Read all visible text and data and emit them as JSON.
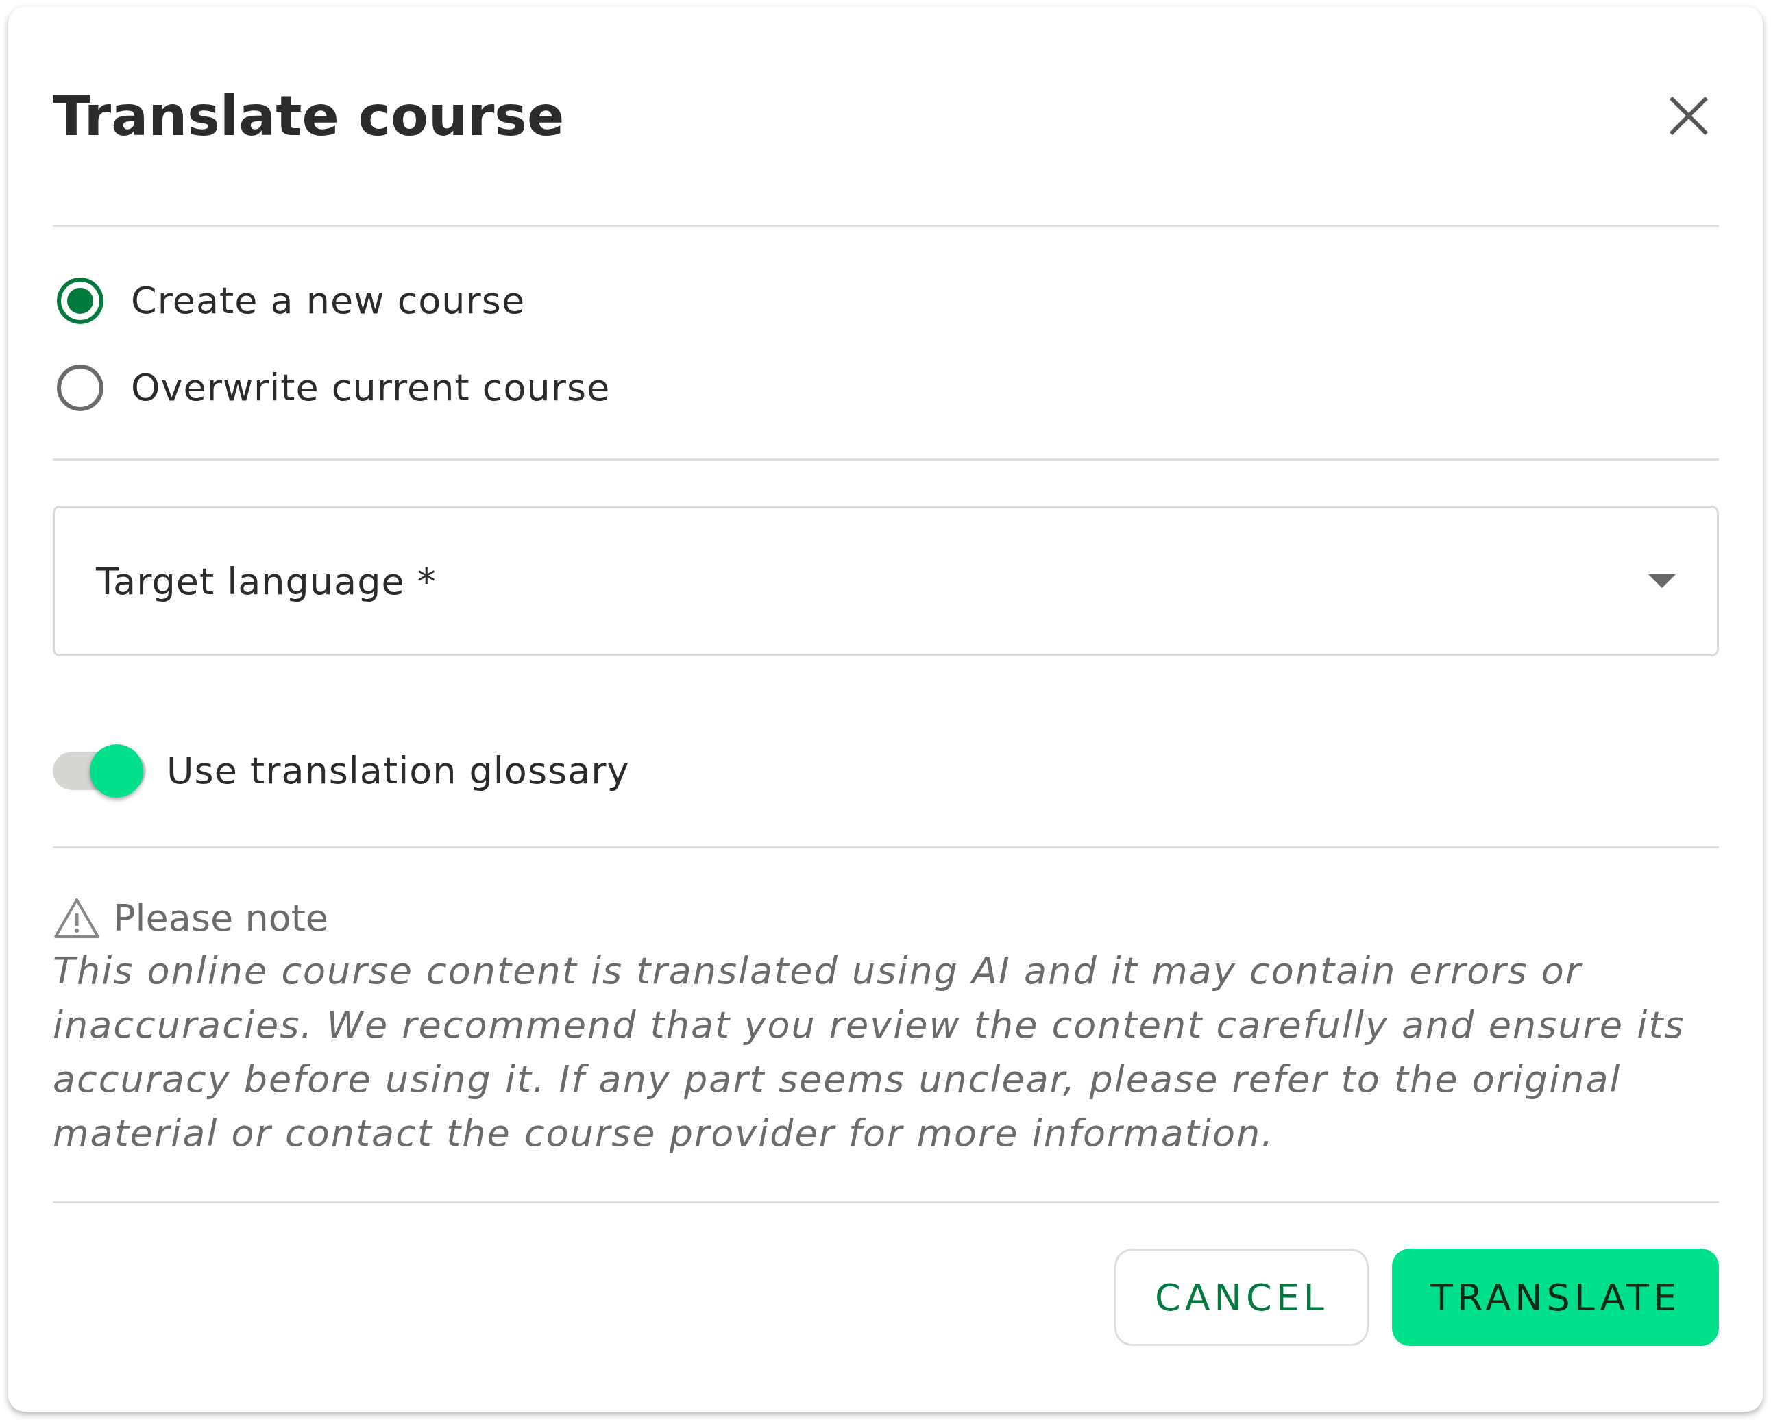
{
  "dialog": {
    "title": "Translate course",
    "options": [
      {
        "label": "Create a new course",
        "selected": true
      },
      {
        "label": "Overwrite current course",
        "selected": false
      }
    ],
    "target_language": {
      "placeholder": "Target language *"
    },
    "glossary_toggle": {
      "label": "Use translation glossary",
      "on": true
    },
    "note": {
      "title": "Please note",
      "text": "This online course content is translated using AI and it may contain errors or inaccuracies. We recommend that you review the content carefully and ensure its accuracy before using it. If any part seems unclear, please refer to the original material or contact the course provider for more information."
    },
    "buttons": [
      {
        "kind": "secondary",
        "label": "CANCEL"
      },
      {
        "kind": "primary",
        "label": "TRANSLATE"
      }
    ]
  }
}
